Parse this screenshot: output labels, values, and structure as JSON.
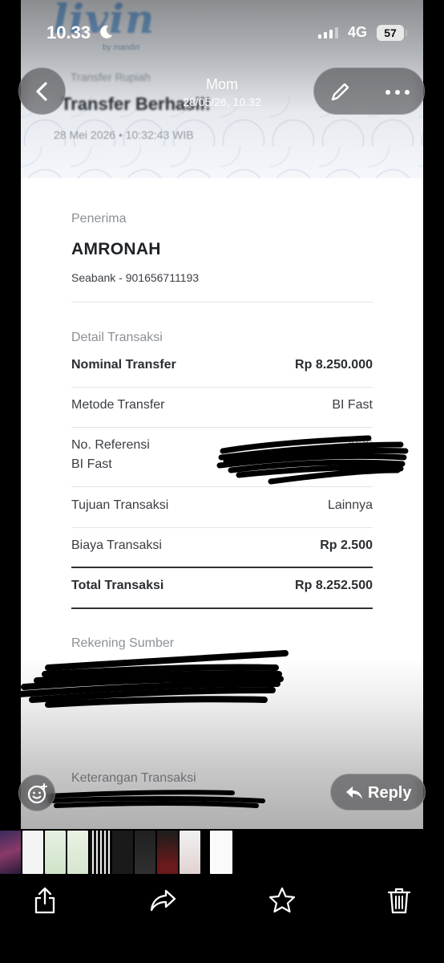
{
  "status_bar": {
    "time": "10.33",
    "network": "4G",
    "battery": "57"
  },
  "header": {
    "contact_name": "Mom",
    "timestamp": "28/05/26, 10.32"
  },
  "receipt": {
    "logo_text": "livin",
    "logo_subtext": "by mandiri",
    "small_heading": "Transfer Rupiah",
    "title": "Transfer Berhasil!",
    "date": "28 Mei 2026 • 10:32:43 WIB",
    "recipient_label": "Penerima",
    "recipient_name": "AMRONAH",
    "recipient_account": "Seabank - 901656711193",
    "detail_label": "Detail Transaksi",
    "rows": [
      {
        "label": "Nominal Transfer",
        "value": "Rp 8.250.000"
      },
      {
        "label": "Metode Transfer",
        "value": "BI Fast"
      },
      {
        "label": "No. Referensi",
        "label2": "BI Fast",
        "value": "2026"
      },
      {
        "label": "Tujuan Transaksi",
        "value": "Lainnya"
      },
      {
        "label": "Biaya Transaksi",
        "value": "Rp 2.500"
      },
      {
        "label": "Total Transaksi",
        "value": "Rp 8.252.500"
      }
    ],
    "source_label": "Rekening Sumber",
    "note_label": "Keterangan Transaksi"
  },
  "actions": {
    "reply_label": "Reply"
  },
  "icons": {
    "back": "chevron-left-icon",
    "edit": "pencil-icon",
    "more": "ellipsis-icon",
    "react": "emoji-add-icon",
    "reply": "reply-arrow-icon",
    "share": "share-icon",
    "forward": "forward-icon",
    "star": "star-icon",
    "delete": "trash-icon"
  }
}
